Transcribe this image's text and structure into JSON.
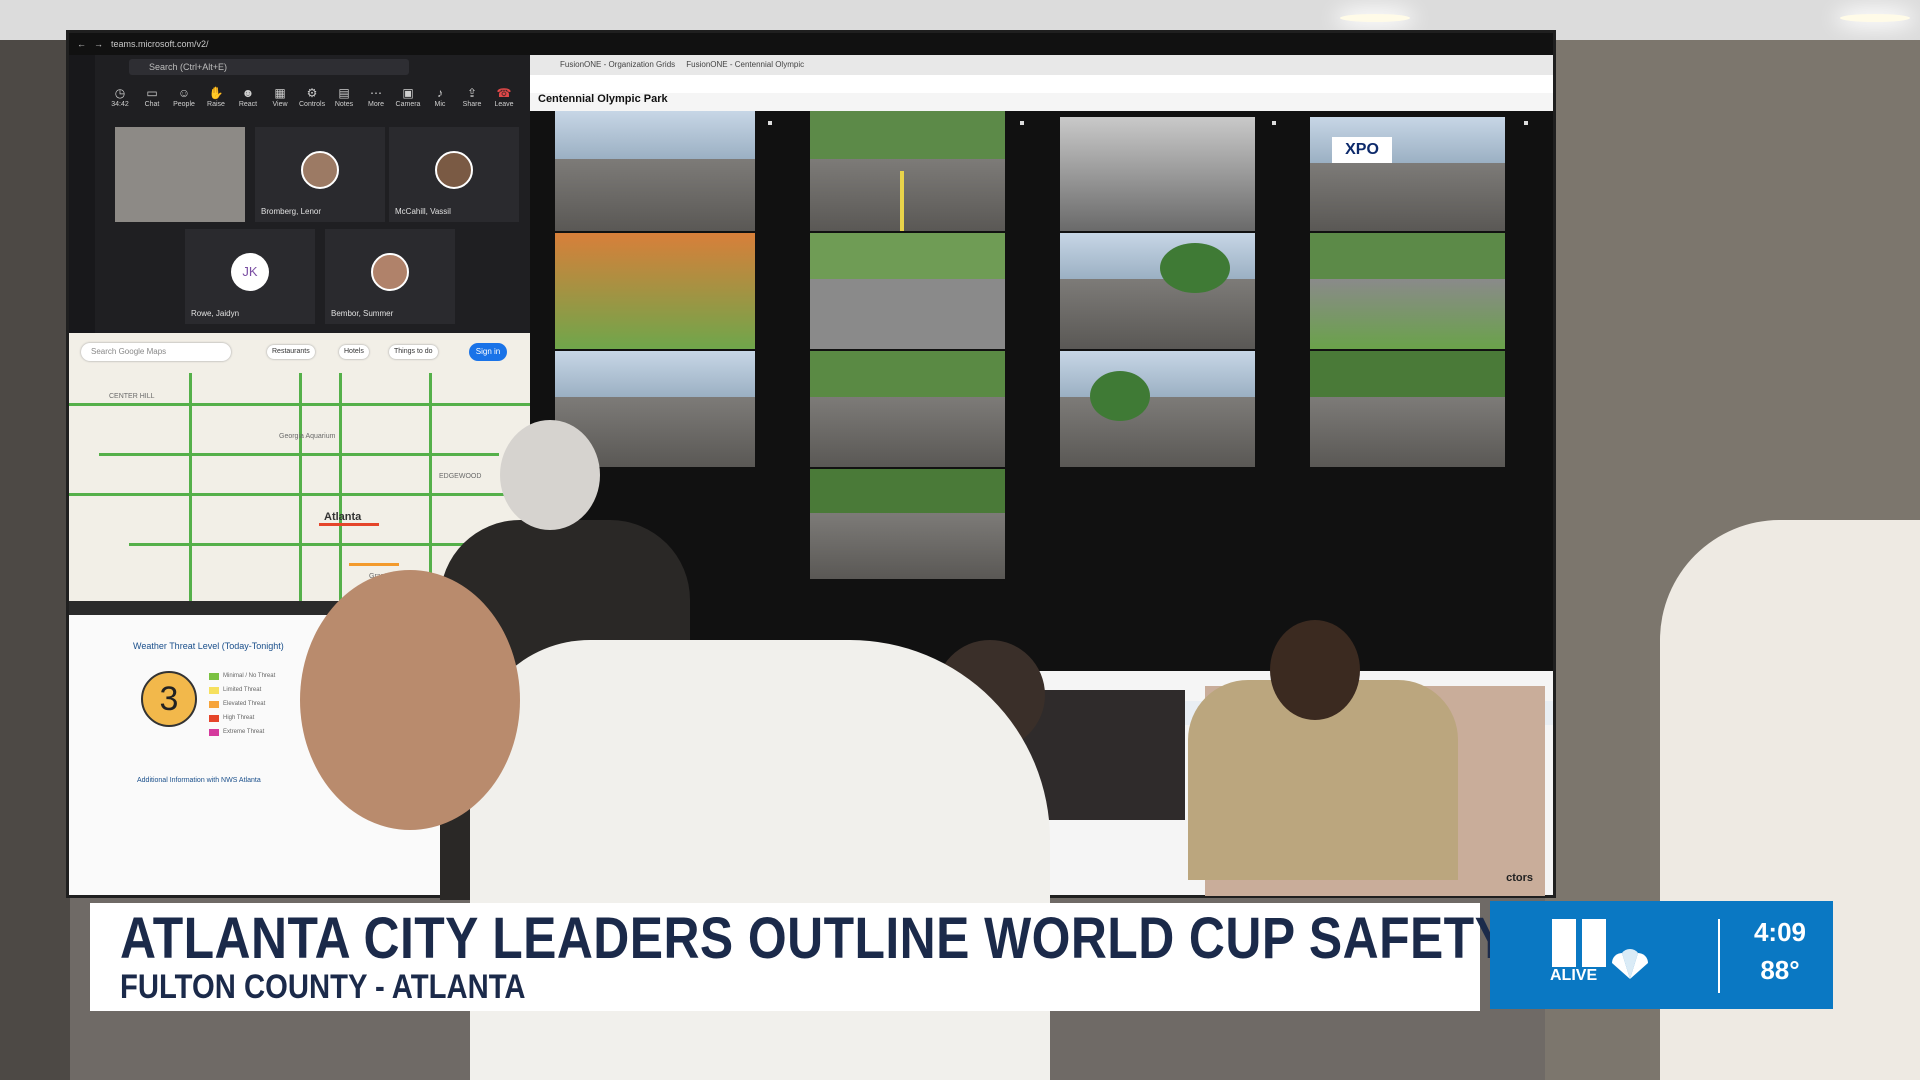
{
  "lower_third": {
    "headline": "ATLANTA CITY LEADERS OUTLINE WORLD CUP SAFETY PLAN",
    "location": "FULTON COUNTY - ATLANTA"
  },
  "station_bug": {
    "logo_text": "ALIVE",
    "time": "4:09",
    "temperature": "88°",
    "brand_color": "#0a78c3"
  },
  "teams_window": {
    "url": "teams.microsoft.com/v2/",
    "search_placeholder": "Search (Ctrl+Alt+E)",
    "call_timer": "34:42",
    "tools": [
      {
        "label": "Chat",
        "icon": "chat-icon"
      },
      {
        "label": "People",
        "icon": "people-icon"
      },
      {
        "label": "Raise",
        "icon": "hand-icon"
      },
      {
        "label": "React",
        "icon": "smile-icon"
      },
      {
        "label": "View",
        "icon": "grid-icon"
      },
      {
        "label": "Controls",
        "icon": "controls-icon"
      },
      {
        "label": "Notes",
        "icon": "notes-icon"
      },
      {
        "label": "More",
        "icon": "more-icon"
      },
      {
        "label": "Camera",
        "icon": "camera-icon"
      },
      {
        "label": "Mic",
        "icon": "mic-icon"
      },
      {
        "label": "Share",
        "icon": "share-icon"
      },
      {
        "label": "Leave",
        "icon": "phone-icon"
      }
    ],
    "participants": [
      "Bromberg, Lenor",
      "McCahill, Vassil",
      "Rowe, Jaidyn",
      "Bembor, Summer"
    ],
    "initials": "JK"
  },
  "map": {
    "search_placeholder": "Search Google Maps",
    "chips": [
      "Restaurants",
      "Hotels",
      "Things to do"
    ],
    "sign_in": "Sign in",
    "city": "Atlanta",
    "labels": [
      "CENTER HILL",
      "Georgia Aquarium",
      "Grant Park",
      "EDGEWOOD"
    ]
  },
  "weather": {
    "title": "Weather Threat Level (Today-Tonight)",
    "level": "3",
    "info": "Additional Information with NWS Atlanta",
    "key": [
      {
        "color": "#7bc142",
        "label": "Minimal / No Threat"
      },
      {
        "color": "#f6e05e",
        "label": "Limited Threat"
      },
      {
        "color": "#f6a43b",
        "label": "Elevated Threat"
      },
      {
        "color": "#e5452a",
        "label": "High Threat"
      },
      {
        "color": "#d53a9d",
        "label": "Extreme Threat"
      }
    ]
  },
  "camera_browser": {
    "title": "Centennial Olympic Park",
    "tabs": [
      "FusionONE - Organization Grids",
      "FusionONE - Centennial Olympic"
    ],
    "truck_text": "XPO"
  },
  "background_monitor": {
    "label": "ctors"
  }
}
